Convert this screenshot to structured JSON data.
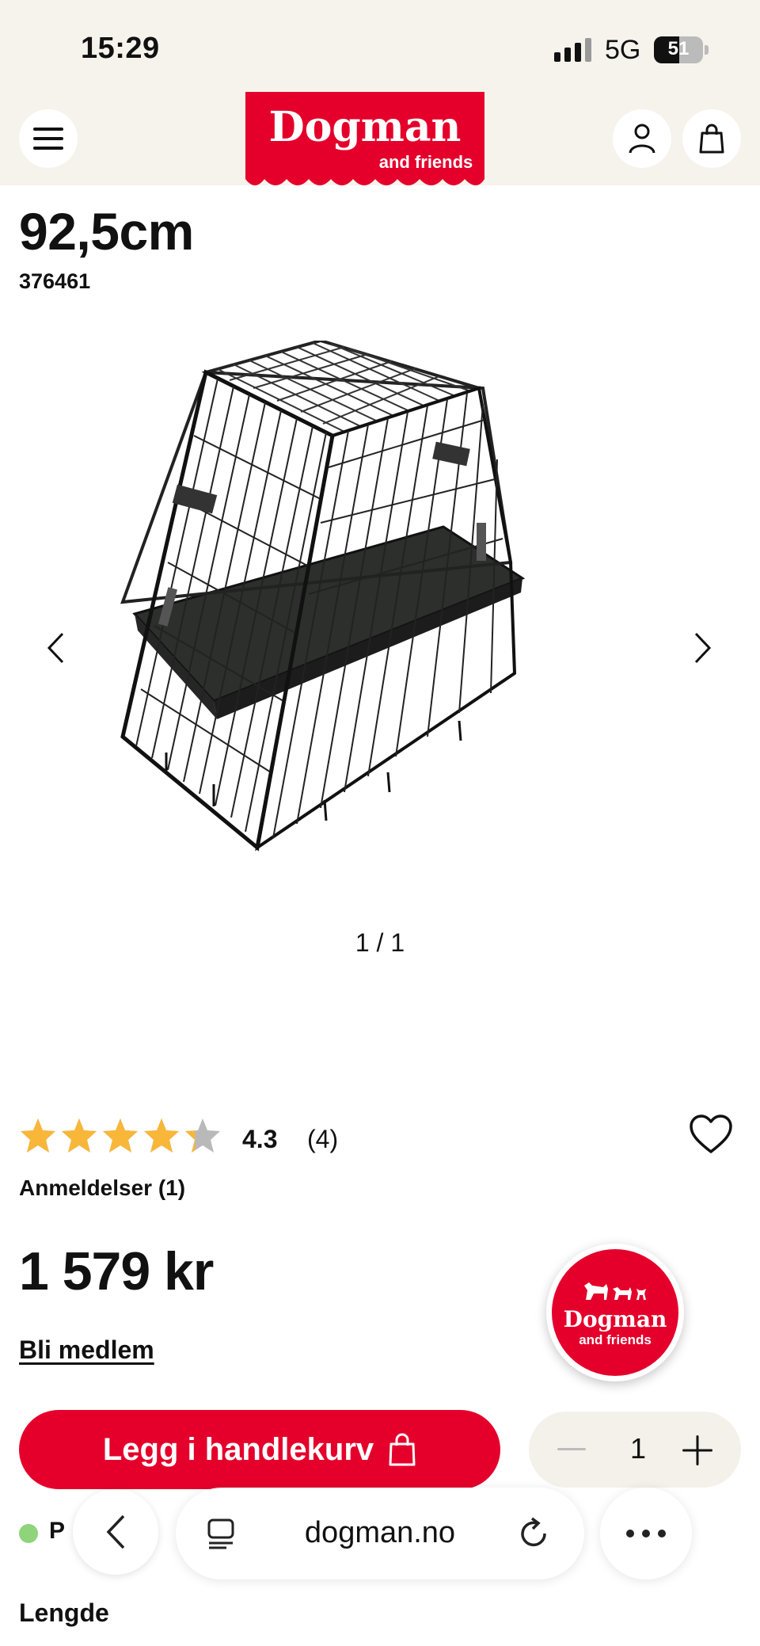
{
  "status_bar": {
    "time": "15:29",
    "network": "5G",
    "battery": "51",
    "battery_level": 0.51
  },
  "header": {
    "brand": "Dogman",
    "brand_sub": "and friends",
    "brand_color": "#e4002b",
    "menu_icon": "hamburger-menu-icon",
    "account_icon": "user-icon",
    "cart_icon": "shopping-bag-icon"
  },
  "product": {
    "title_line2": "92,5cm",
    "sku": "376461",
    "image_icon": "dog-crate-image",
    "gallery_counter": "1 / 1",
    "rating": "4.3",
    "rating_value": 4.3,
    "rating_count": "(4)",
    "reviews_link": "Anmeldelser (1)",
    "price": "1 579 kr",
    "member_link": "Bli medlem",
    "add_to_cart": "Legg i handlekurv",
    "quantity": "1",
    "stock_text": "P",
    "attribute_label": "Lengde"
  },
  "badge": {
    "brand": "Dogman",
    "sub": "and friends"
  },
  "browser": {
    "url": "dogman.no"
  },
  "colors": {
    "accent": "#e4002b",
    "star": "#f8b739",
    "star_empty": "#b9b9b9",
    "in_stock": "#8fd37a"
  }
}
